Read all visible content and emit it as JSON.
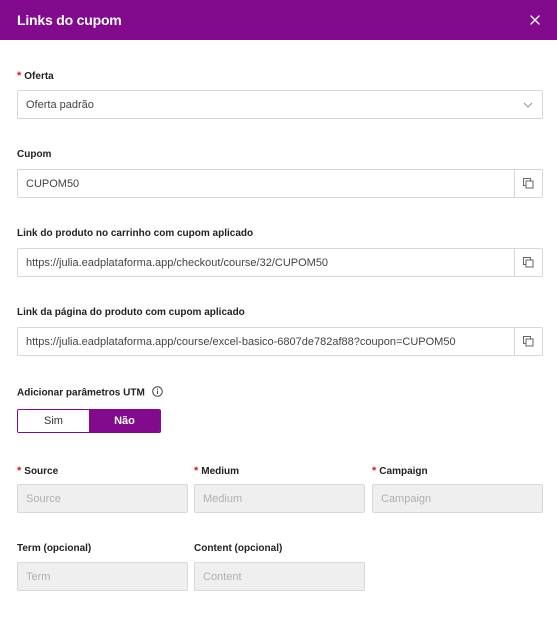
{
  "header": {
    "title": "Links do cupom",
    "close_icon": "close-icon"
  },
  "colors": {
    "brand": "#820a8c",
    "required": "#d11a2a"
  },
  "oferta": {
    "label": "Oferta",
    "value": "Oferta padrão"
  },
  "cupom": {
    "label": "Cupom",
    "value": "CUPOM50"
  },
  "link_carrinho": {
    "label": "Link do produto no carrinho com cupom aplicado",
    "value": "https://julia.eadplataforma.app/checkout/course/32/CUPOM50"
  },
  "link_pagina": {
    "label": "Link da página do produto com cupom aplicado",
    "value": "https://julia.eadplataforma.app/course/excel-basico-6807de782af88?coupon=CUPOM50"
  },
  "utm": {
    "label": "Adicionar parâmetros UTM",
    "options": [
      "Sim",
      "Não"
    ],
    "selected": "Não",
    "source": {
      "label": "Source",
      "placeholder": "Source"
    },
    "medium": {
      "label": "Medium",
      "placeholder": "Medium"
    },
    "campaign": {
      "label": "Campaign",
      "placeholder": "Campaign"
    },
    "term": {
      "label": "Term (opcional)",
      "placeholder": "Term"
    },
    "content": {
      "label": "Content (opcional)",
      "placeholder": "Content"
    }
  }
}
